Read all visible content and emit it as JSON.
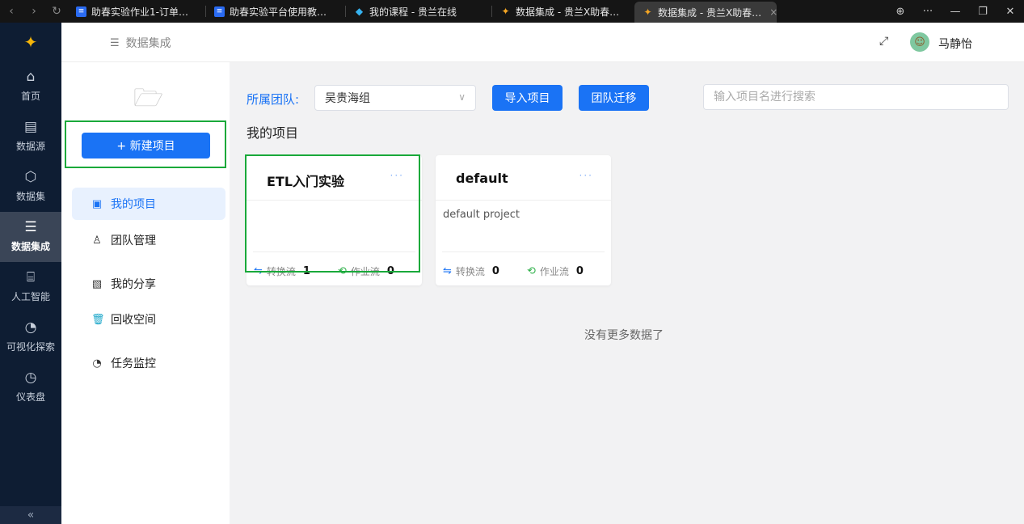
{
  "browser": {
    "tabs": [
      {
        "title": "助春实验作业1-订单…",
        "icon": "doc-icon"
      },
      {
        "title": "助春实验平台使用教…",
        "icon": "doc-icon"
      },
      {
        "title": "我的课程 - 贵兰在线",
        "icon": "graduation-cap-icon"
      },
      {
        "title": "数据集成 - 贵兰X助春…",
        "icon": "sparkle-logo-icon"
      },
      {
        "title": "数据集成 - 贵兰X助春…",
        "icon": "sparkle-logo-icon",
        "active": true
      }
    ]
  },
  "leftnav": {
    "items": [
      {
        "label": "首页",
        "icon": "home-icon"
      },
      {
        "label": "数据源",
        "icon": "datasource-icon"
      },
      {
        "label": "数据集",
        "icon": "cube-icon"
      },
      {
        "label": "数据集成",
        "icon": "server-icon",
        "active": true
      },
      {
        "label": "人工智能",
        "icon": "ai-scan-icon"
      },
      {
        "label": "可视化探索",
        "icon": "pie-chart-icon"
      },
      {
        "label": "仪表盘",
        "icon": "dashboard-gauge-icon"
      }
    ],
    "collapse": "«"
  },
  "header": {
    "breadcrumb": "数据集成",
    "username": "马静怡"
  },
  "subside": {
    "new_button": "+ 新建项目",
    "menu": [
      {
        "label": "我的项目",
        "icon": "project-board-icon",
        "active": true
      },
      {
        "label": "团队管理",
        "icon": "user-icon"
      },
      {
        "label": "我的分享",
        "icon": "share-doc-icon"
      },
      {
        "label": "回收空间",
        "icon": "trash-icon"
      },
      {
        "label": "任务监控",
        "icon": "monitor-pie-icon"
      }
    ]
  },
  "toolbar": {
    "team_label": "所属团队:",
    "team_value": "吴贵海组",
    "import_button": "导入项目",
    "migrate_button": "团队迁移",
    "search_placeholder": "输入项目名进行搜索"
  },
  "main": {
    "section_title": "我的项目",
    "projects": [
      {
        "name": "ETL入门实验",
        "description": "",
        "transform_label": "转换流",
        "transform_count": "1",
        "job_label": "作业流",
        "job_count": "0"
      },
      {
        "name": "default",
        "description": "default project",
        "transform_label": "转换流",
        "transform_count": "0",
        "job_label": "作业流",
        "job_count": "0"
      }
    ],
    "no_more": "没有更多数据了"
  },
  "colors": {
    "primary": "#1a73f5",
    "nav_bg": "#0e1d33",
    "highlight_box": "#19a93a"
  }
}
